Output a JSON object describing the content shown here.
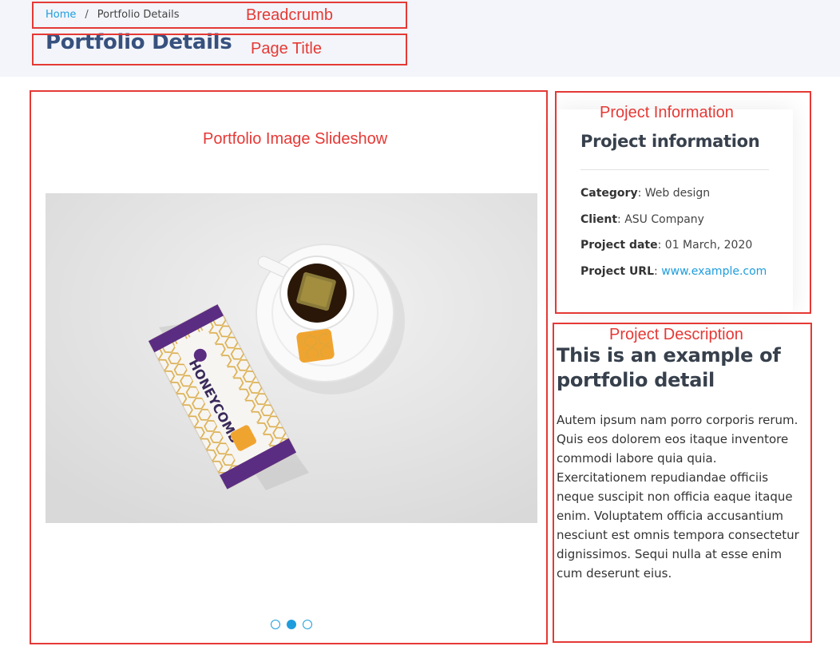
{
  "breadcrumb": {
    "home": "Home",
    "separator": "/",
    "current": "Portfolio Details"
  },
  "page_title": "Portfolio Details",
  "annotations": {
    "breadcrumb": "Breadcrumb",
    "page_title": "Page Title",
    "slideshow": "Portfolio Image Slideshow",
    "project_information": "Project Information",
    "project_description": "Project Description"
  },
  "slideshow": {
    "image_icon": "honeycomb-tea-photo",
    "dots": [
      {
        "active": false
      },
      {
        "active": true
      },
      {
        "active": false
      }
    ]
  },
  "project_info": {
    "title": "Project information",
    "rows": [
      {
        "label": "Category",
        "value": "Web design"
      },
      {
        "label": "Client",
        "value": "ASU Company"
      },
      {
        "label": "Project date",
        "value": "01 March, 2020"
      },
      {
        "label": "Project URL",
        "value": "www.example.com"
      }
    ]
  },
  "description": {
    "title": "This is an example of portfolio detail",
    "text": "Autem ipsum nam porro corporis rerum. Quis eos dolorem eos itaque inventore commodi labore quia quia. Exercitationem repudiandae officiis neque suscipit non officia eaque itaque enim. Voluptatem officia accusantium nesciunt est omnis tempora consectetur dignissimos. Sequi nulla at esse enim cum deserunt eius."
  },
  "colors": {
    "accent": "#1e9ddd",
    "title": "#37517e",
    "annotation": "#e53935",
    "band": "#f3f5fa"
  }
}
